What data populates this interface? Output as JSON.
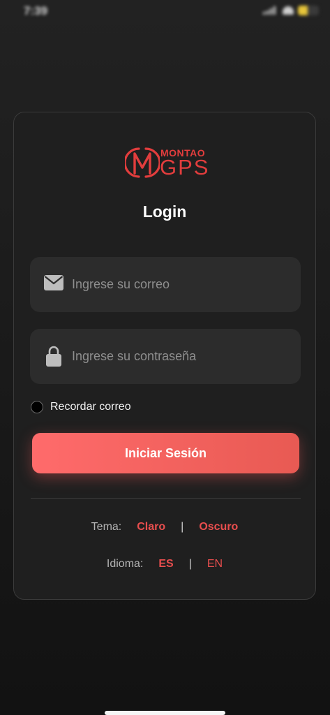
{
  "status_bar": {
    "time": "7:39",
    "battery_level": 0.45
  },
  "logo": {
    "top_text": "MONTAO",
    "main_text": "GPS"
  },
  "title": "Login",
  "email_field": {
    "placeholder": "Ingrese su correo",
    "value": "",
    "icon": "envelope-icon"
  },
  "password_field": {
    "placeholder": "Ingrese su contraseña",
    "value": "",
    "icon": "lock-icon"
  },
  "remember": {
    "label": "Recordar correo",
    "checked": false
  },
  "login_button": {
    "label": "Iniciar Sesión"
  },
  "theme": {
    "label": "Tema:",
    "option_light": "Claro",
    "separator": "|",
    "option_dark": "Oscuro"
  },
  "language": {
    "label": "Idioma:",
    "option_es": "ES",
    "separator": "|",
    "option_en": "EN"
  },
  "colors": {
    "accent": "#e84e4e",
    "button_start": "#ff6b6b",
    "button_end": "#e85a53",
    "card_bg": "#1f1f1f",
    "field_bg": "#2c2c2c"
  }
}
